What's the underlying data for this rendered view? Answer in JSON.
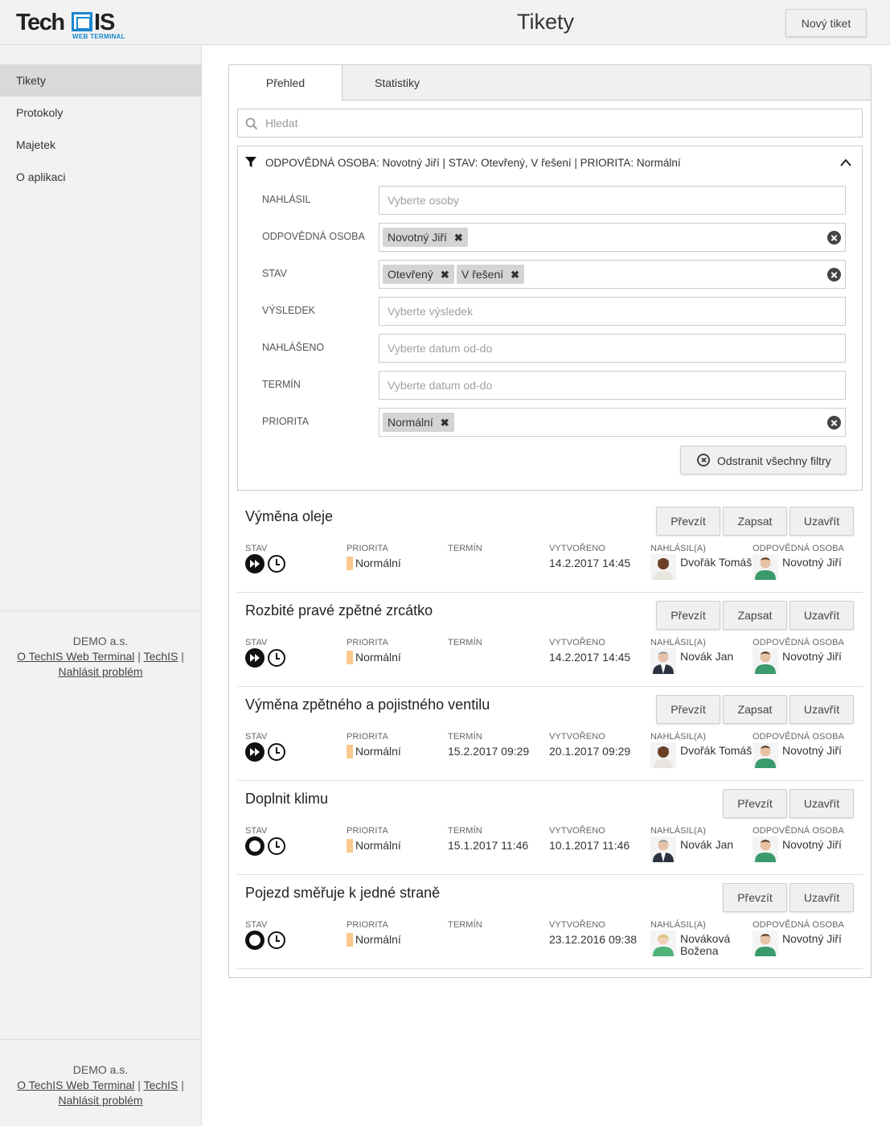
{
  "header": {
    "logo_tech": "Tech",
    "logo_is": "IS",
    "logo_sub": "WEB TERMINAL",
    "title": "Tikety",
    "new_ticket": "Nový tiket"
  },
  "sidebar": {
    "items": [
      {
        "label": "Tikety",
        "active": true
      },
      {
        "label": "Protokoly"
      },
      {
        "label": "Majetek"
      },
      {
        "label": "O aplikaci"
      }
    ],
    "footer": {
      "company": "DEMO a.s.",
      "link1": "O TechIS Web Terminal",
      "link2": "TechIS",
      "link3": "Nahlásit problém"
    }
  },
  "tabs": [
    "Přehled",
    "Statistiky"
  ],
  "search": {
    "placeholder": "Hledat"
  },
  "filter": {
    "summary": "ODPOVĚDNÁ OSOBA: Novotný Jiří | STAV: Otevřený, V řešení | PRIORITA: Normální",
    "rows": {
      "nahlasil": {
        "label": "NAHLÁSIL",
        "placeholder": "Vyberte osoby"
      },
      "odpovedna": {
        "label": "ODPOVĚDNÁ OSOBA",
        "chips": [
          "Novotný Jiří"
        ]
      },
      "stav": {
        "label": "STAV",
        "chips": [
          "Otevřený",
          "V řešení"
        ]
      },
      "vysledek": {
        "label": "VÝSLEDEK",
        "placeholder": "Vyberte výsledek"
      },
      "nahlaseno": {
        "label": "NAHLÁŠENO",
        "placeholder": "Vyberte datum od-do"
      },
      "termin": {
        "label": "TERMÍN",
        "placeholder": "Vyberte datum od-do"
      },
      "priorita": {
        "label": "PRIORITA",
        "chips": [
          "Normální"
        ]
      }
    },
    "remove_all": "Odstranit všechny filtry"
  },
  "columns": {
    "stav": "STAV",
    "priorita": "PRIORITA",
    "termin": "TERMÍN",
    "vytvoreno": "VYTVOŘENO",
    "nahlasil": "NAHLÁSIL(A)",
    "odpovedna": "ODPOVĚDNÁ OSOBA"
  },
  "actions": {
    "prevzit": "Převzít",
    "zapsat": "Zapsat",
    "uzavrit": "Uzavřít"
  },
  "tickets": [
    {
      "title": "Výměna oleje",
      "status": "in-progress",
      "priority": "Normální",
      "termin": "",
      "created": "14.2.2017 14:45",
      "reporter": "Dvořák Tomáš",
      "responsible": "Novotný Jiří"
    },
    {
      "title": "Rozbité pravé zpětné zrcátko",
      "status": "in-progress",
      "priority": "Normální",
      "termin": "",
      "created": "14.2.2017 14:45",
      "reporter": "Novák Jan",
      "responsible": "Novotný Jiří"
    },
    {
      "title": "Výměna zpětného a pojistného ventilu",
      "status": "in-progress",
      "priority": "Normální",
      "termin": "15.2.2017 09:29",
      "created": "20.1.2017 09:29",
      "reporter": "Dvořák Tomáš",
      "responsible": "Novotný Jiří"
    },
    {
      "title": "Doplnit klimu",
      "status": "open",
      "priority": "Normální",
      "termin": "15.1.2017 11:46",
      "created": "10.1.2017 11:46",
      "reporter": "Novák Jan",
      "responsible": "Novotný Jiří"
    },
    {
      "title": "Pojezd směřuje k jedné straně",
      "status": "open",
      "priority": "Normální",
      "termin": "",
      "created": "23.12.2016 09:38",
      "reporter": "Nováková Božena",
      "responsible": "Novotný Jiří"
    }
  ],
  "colors": {
    "accent": "#1a86d0",
    "priority": "#f9c98d",
    "sidebar_bg": "#f2f2f2",
    "active_bg": "#d9d9d9"
  }
}
